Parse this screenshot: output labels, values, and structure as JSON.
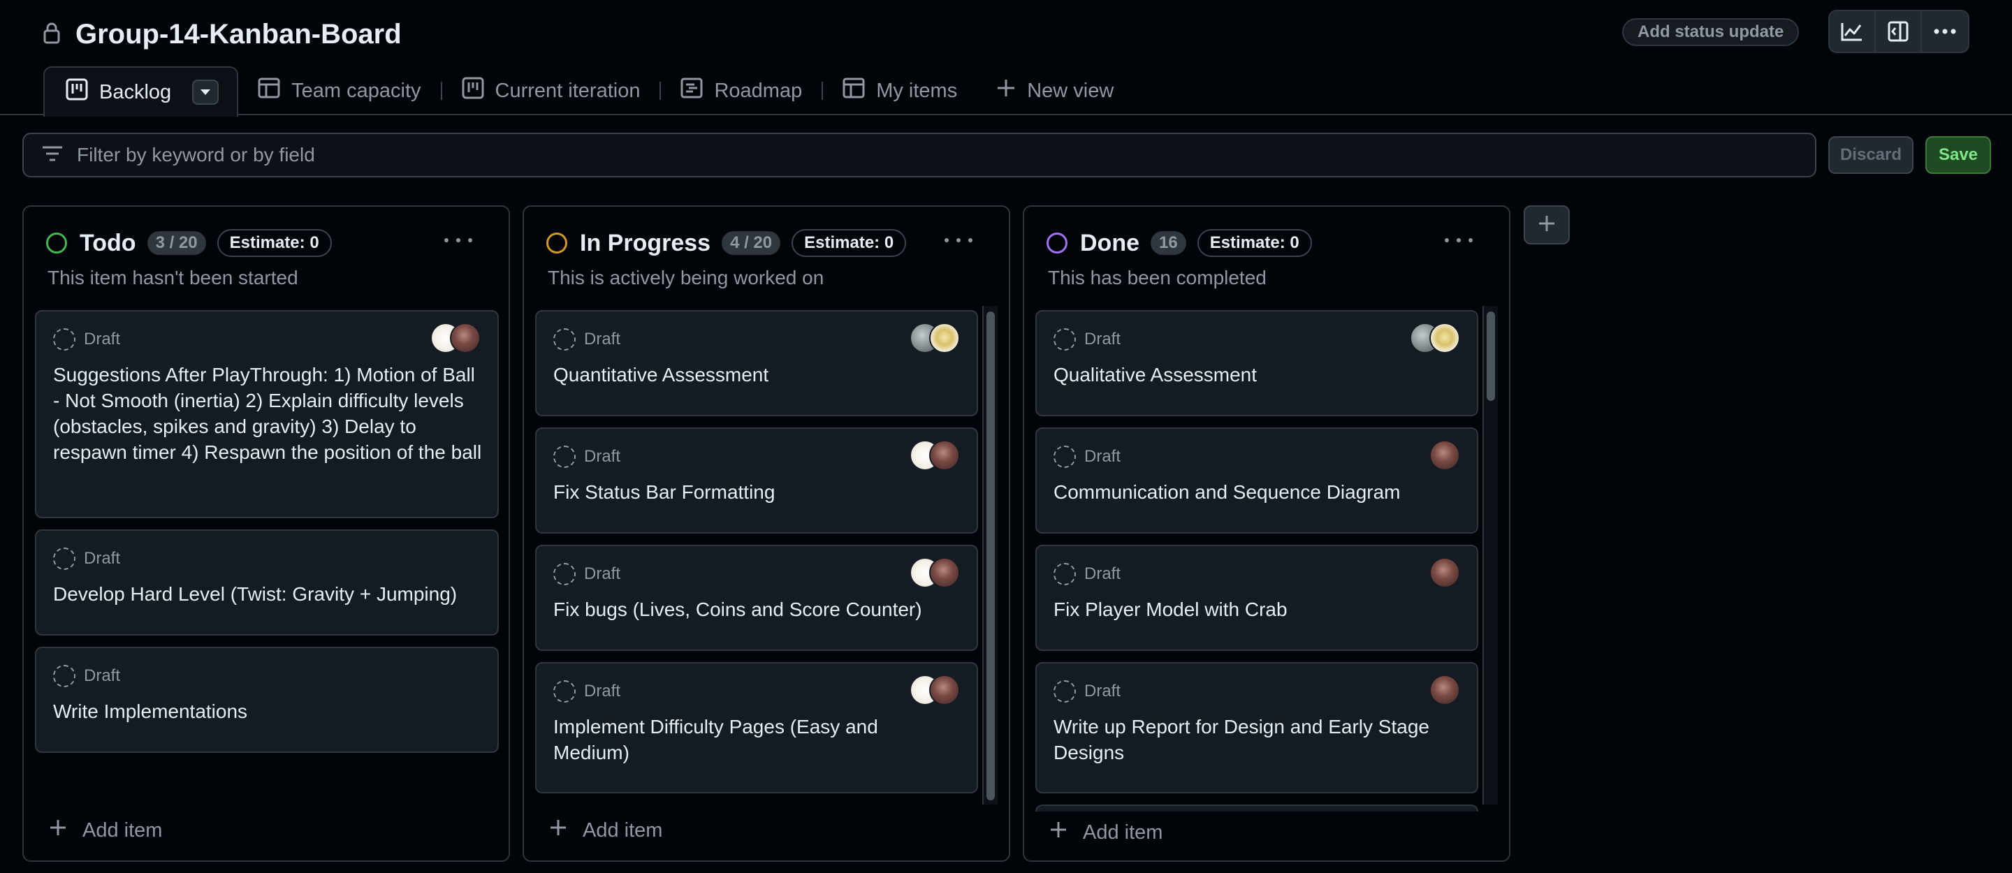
{
  "project": {
    "title": "Group-14-Kanban-Board"
  },
  "header": {
    "status_update_label": "Add status update",
    "actions": [
      "insights-icon",
      "panel-icon",
      "more-icon"
    ]
  },
  "tabs": [
    {
      "label": "Backlog",
      "icon": "board-icon",
      "active": true
    },
    {
      "label": "Team capacity",
      "icon": "table-icon"
    },
    {
      "label": "Current iteration",
      "icon": "board-icon"
    },
    {
      "label": "Roadmap",
      "icon": "roadmap-icon"
    },
    {
      "label": "My items",
      "icon": "table-icon"
    },
    {
      "label": "New view",
      "icon": "plus-icon"
    }
  ],
  "filter": {
    "placeholder": "Filter by keyword or by field"
  },
  "buttons": {
    "discard": "Discard",
    "save": "Save"
  },
  "columns": [
    {
      "name": "Todo",
      "count": "3 / 20",
      "estimate": "Estimate: 0",
      "color": "#3fb950",
      "description": "This item hasn't been started",
      "add_item": "Add item",
      "cards": [
        {
          "status": "Draft",
          "title": "Suggestions After PlayThrough: 1) Motion of Ball - Not Smooth (inertia) 2) Explain difficulty levels (obstacles, spikes and gravity) 3) Delay to respawn timer 4) Respawn the position of the ball"
        },
        {
          "status": "Draft",
          "title": "Develop Hard Level (Twist: Gravity + Jumping)"
        },
        {
          "status": "Draft",
          "title": "Write Implementations"
        }
      ]
    },
    {
      "name": "In Progress",
      "count": "4 / 20",
      "estimate": "Estimate: 0",
      "color": "#d29922",
      "description": "This is actively being worked on",
      "add_item": "Add item",
      "cards": [
        {
          "status": "Draft",
          "title": "Quantitative Assessment"
        },
        {
          "status": "Draft",
          "title": "Fix Status Bar Formatting"
        },
        {
          "status": "Draft",
          "title": "Fix bugs (Lives, Coins and Score Counter)"
        },
        {
          "status": "Draft",
          "title": "Implement Difficulty Pages (Easy and Medium)"
        }
      ]
    },
    {
      "name": "Done",
      "count": "16",
      "estimate": "Estimate: 0",
      "color": "#a371f7",
      "description": "This has been completed",
      "add_item": "Add item",
      "cards": [
        {
          "status": "Draft",
          "title": "Qualitative Assessment"
        },
        {
          "status": "Draft",
          "title": "Communication and Sequence Diagram"
        },
        {
          "status": "Draft",
          "title": "Fix Player Model with Crab"
        },
        {
          "status": "Draft",
          "title": "Write up Report for Design and Early Stage Designs"
        }
      ]
    }
  ]
}
